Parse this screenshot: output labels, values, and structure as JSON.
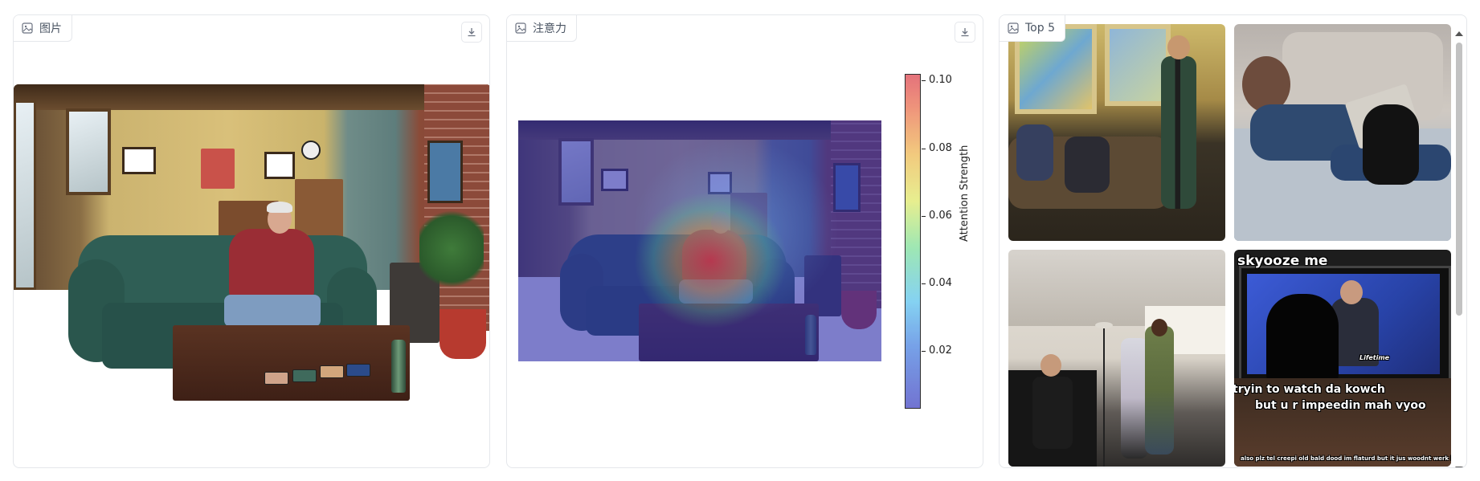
{
  "panels": {
    "image": {
      "label": "图片",
      "icon": "image-icon",
      "download_icon": "download-icon"
    },
    "attention": {
      "label": "注意力",
      "icon": "image-icon",
      "download_icon": "download-icon"
    },
    "top5": {
      "label": "Top 5",
      "icon": "image-icon"
    }
  },
  "colorbar": {
    "title": "Attention Strength",
    "ticks": [
      "0.10",
      "0.08",
      "0.06",
      "0.04",
      "0.02"
    ],
    "range": [
      0.003,
      0.102
    ]
  },
  "gallery": {
    "meme_top": "skyooze me",
    "meme_mid1": "tryin to watch da kowch",
    "meme_mid2": "but u r impeedin mah vyoo",
    "meme_bottom": "also plz tel creepi old bald dood im flaturd but it jus woodnt werk kthxbai",
    "tv_logo": "Lifetime"
  },
  "colors": {
    "border": "#e5e7eb",
    "label_text": "#4b5563"
  }
}
